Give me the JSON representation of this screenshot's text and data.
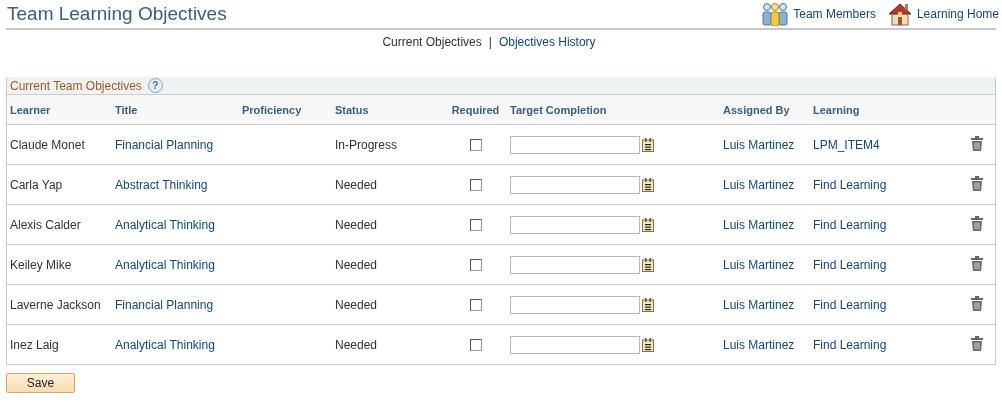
{
  "page_title": "Team Learning Objectives",
  "header_links": [
    {
      "kind": "team",
      "label": "Team Members"
    },
    {
      "kind": "home",
      "label": "Learning Home"
    }
  ],
  "nav": [
    {
      "label": "Current Objectives",
      "selected": true
    },
    {
      "label": "Objectives History",
      "selected": false
    }
  ],
  "nav_separator": "|",
  "section_title": "Current Team Objectives",
  "help_glyph": "?",
  "columns": [
    "Learner",
    "Title",
    "Proficiency",
    "Status",
    "Required",
    "Target Completion",
    "Assigned By",
    "Learning"
  ],
  "rows": [
    {
      "learner": "Claude Monet",
      "title": "Financial Planning",
      "status": "In-Progress",
      "required": false,
      "assigned_by": "Luis Martinez",
      "learning": "LPM_ITEM4"
    },
    {
      "learner": "Carla Yap",
      "title": "Abstract Thinking",
      "status": "Needed",
      "required": false,
      "assigned_by": "Luis Martinez",
      "learning": "Find Learning"
    },
    {
      "learner": "Alexis Calder",
      "title": "Analytical Thinking",
      "status": "Needed",
      "required": false,
      "assigned_by": "Luis Martinez",
      "learning": "Find Learning"
    },
    {
      "learner": "Keiley Mike",
      "title": "Analytical Thinking",
      "status": "Needed",
      "required": false,
      "assigned_by": "Luis Martinez",
      "learning": "Find Learning"
    },
    {
      "learner": "Laverne Jackson",
      "title": "Financial Planning",
      "status": "Needed",
      "required": false,
      "assigned_by": "Luis Martinez",
      "learning": "Find Learning"
    },
    {
      "learner": "Inez Laig",
      "title": "Analytical Thinking",
      "status": "Needed",
      "required": false,
      "assigned_by": "Luis Martinez",
      "learning": "Find Learning"
    }
  ],
  "save_button": "Save"
}
